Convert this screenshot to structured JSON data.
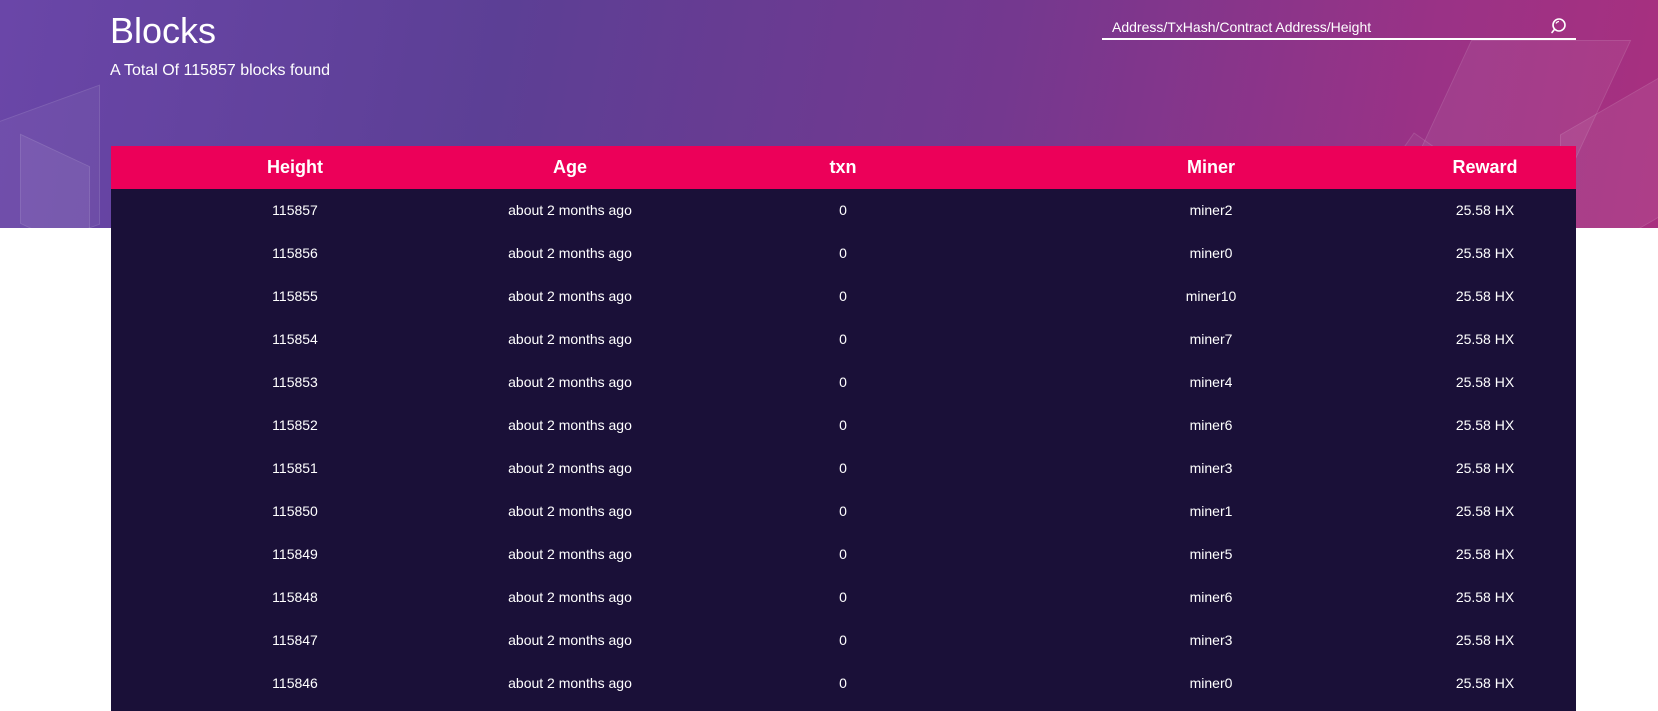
{
  "header": {
    "title": "Blocks",
    "subtitle_prefix": "A Total Of",
    "total_blocks": "115857",
    "subtitle_suffix": "blocks found"
  },
  "search": {
    "placeholder": "Address/TxHash/Contract Address/Height",
    "icon": "search-icon"
  },
  "colors": {
    "header_gradient_start": "#6a46a8",
    "header_gradient_end": "#a8307f",
    "table_header": "#ec0059",
    "table_body": "#1a1038",
    "text": "#ffffff"
  },
  "table": {
    "columns": [
      "Height",
      "Age",
      "txn",
      "Miner",
      "Reward"
    ],
    "rows": [
      {
        "height": "115857",
        "age": "about 2 months ago",
        "txn": "0",
        "miner": "miner2",
        "reward": "25.58 HX"
      },
      {
        "height": "115856",
        "age": "about 2 months ago",
        "txn": "0",
        "miner": "miner0",
        "reward": "25.58 HX"
      },
      {
        "height": "115855",
        "age": "about 2 months ago",
        "txn": "0",
        "miner": "miner10",
        "reward": "25.58 HX"
      },
      {
        "height": "115854",
        "age": "about 2 months ago",
        "txn": "0",
        "miner": "miner7",
        "reward": "25.58 HX"
      },
      {
        "height": "115853",
        "age": "about 2 months ago",
        "txn": "0",
        "miner": "miner4",
        "reward": "25.58 HX"
      },
      {
        "height": "115852",
        "age": "about 2 months ago",
        "txn": "0",
        "miner": "miner6",
        "reward": "25.58 HX"
      },
      {
        "height": "115851",
        "age": "about 2 months ago",
        "txn": "0",
        "miner": "miner3",
        "reward": "25.58 HX"
      },
      {
        "height": "115850",
        "age": "about 2 months ago",
        "txn": "0",
        "miner": "miner1",
        "reward": "25.58 HX"
      },
      {
        "height": "115849",
        "age": "about 2 months ago",
        "txn": "0",
        "miner": "miner5",
        "reward": "25.58 HX"
      },
      {
        "height": "115848",
        "age": "about 2 months ago",
        "txn": "0",
        "miner": "miner6",
        "reward": "25.58 HX"
      },
      {
        "height": "115847",
        "age": "about 2 months ago",
        "txn": "0",
        "miner": "miner3",
        "reward": "25.58 HX"
      },
      {
        "height": "115846",
        "age": "about 2 months ago",
        "txn": "0",
        "miner": "miner0",
        "reward": "25.58 HX"
      }
    ]
  }
}
